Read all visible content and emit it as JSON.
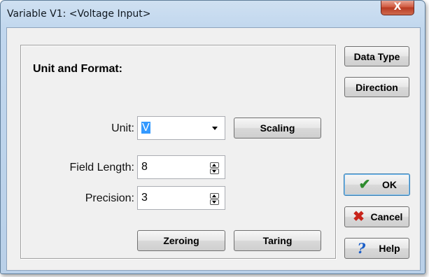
{
  "window": {
    "title": "Variable V1: <Voltage Input>",
    "close_glyph": "X"
  },
  "group": {
    "title": "Unit and Format:"
  },
  "unit": {
    "label": "Unit:",
    "value": "V",
    "scaling_button": "Scaling"
  },
  "field_length": {
    "label": "Field Length:",
    "value": "8"
  },
  "precision": {
    "label": "Precision:",
    "value": "3"
  },
  "buttons": {
    "zeroing": "Zeroing",
    "taring": "Taring",
    "data_type": "Data Type",
    "direction": "Direction",
    "ok": "OK",
    "cancel": "Cancel",
    "help": "Help"
  },
  "icons": {
    "ok": "check-icon",
    "cancel": "x-icon",
    "help": "question-icon"
  },
  "colors": {
    "selection": "#3399ff",
    "ok_icon": "#2e8b2e",
    "cancel_icon": "#c8241b",
    "help_icon": "#1b5ec8"
  }
}
